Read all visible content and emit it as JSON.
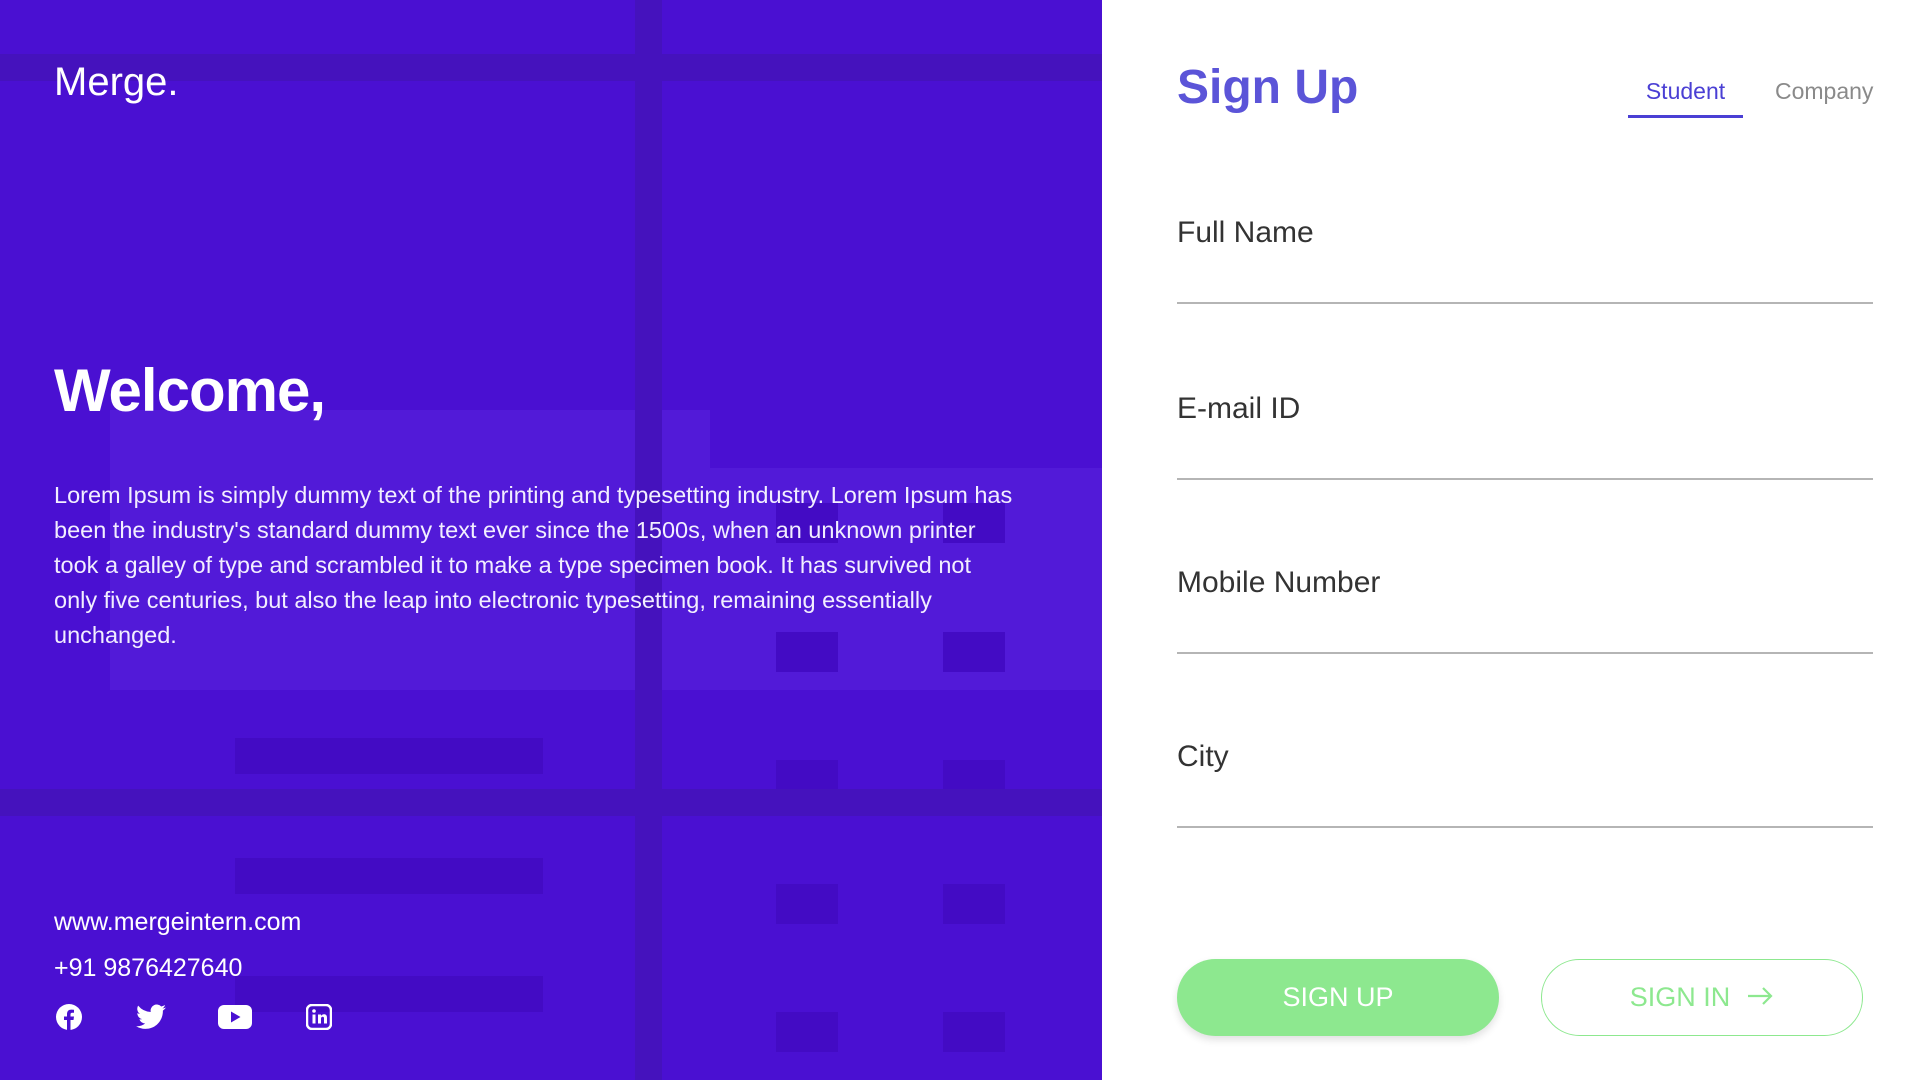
{
  "brand": {
    "logo": "Merge."
  },
  "welcome": {
    "heading": "Welcome,",
    "body": "Lorem Ipsum is simply dummy text of the printing and typesetting industry. Lorem Ipsum has been the industry's standard dummy text ever since the 1500s, when an unknown printer took a galley of type and scrambled it to make a type specimen book. It has survived not only five centuries, but also the leap into electronic typesetting, remaining essentially unchanged."
  },
  "contact": {
    "website": "www.mergeintern.com",
    "phone": "+91 9876427640"
  },
  "social": [
    "facebook-icon",
    "twitter-icon",
    "youtube-icon",
    "linkedin-icon"
  ],
  "form": {
    "title": "Sign Up",
    "tabs": [
      {
        "label": "Student",
        "active": true
      },
      {
        "label": "Company",
        "active": false
      }
    ],
    "fields": [
      {
        "label": "Full Name"
      },
      {
        "label": "E-mail ID"
      },
      {
        "label": "Mobile Number"
      },
      {
        "label": "City"
      }
    ],
    "signup_label": "SIGN UP",
    "signin_label": "SIGN IN"
  },
  "colors": {
    "panel": "#4a10d2",
    "accent": "#5b54d8",
    "green": "#8de88f"
  }
}
